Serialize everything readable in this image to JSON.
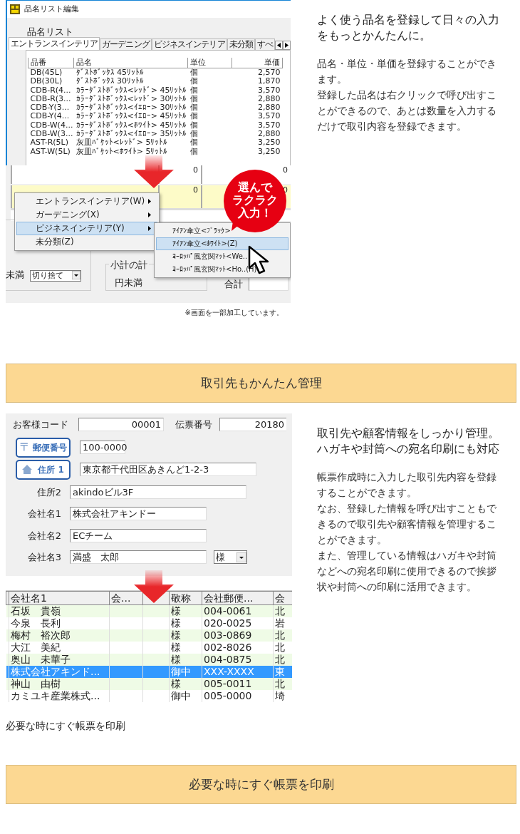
{
  "product_section": {
    "window": {
      "title": "品名リスト編集",
      "list_label": "品名リスト",
      "tabs": [
        {
          "label": "エントランスインテリア",
          "selected": true
        },
        {
          "label": "ガーデニング",
          "selected": false
        },
        {
          "label": "ビジネスインテリア",
          "selected": false
        },
        {
          "label": "未分類",
          "selected": false
        },
        {
          "label": "すべ",
          "selected": false
        }
      ],
      "table": {
        "columns": [
          "品番",
          "品名",
          "単位",
          "単価"
        ],
        "rows": [
          [
            "DB(45L)",
            "ﾀﾞｽﾄﾎﾞｯｸｽ 45ﾘｯﾄﾙ",
            "個",
            "2,570"
          ],
          [
            "DB(30L)",
            "ﾀﾞｽﾄﾎﾞｯｸｽ 30ﾘｯﾄﾙ",
            "個",
            "1,870"
          ],
          [
            "CDB-R(4...",
            "ｶﾗｰﾀﾞｽﾄﾎﾞｯｸｽ<ﾚｯﾄﾞ> 45ﾘｯﾄﾙ",
            "個",
            "3,570"
          ],
          [
            "CDB-R(3...",
            "ｶﾗｰﾀﾞｽﾄﾎﾞｯｸｽ<ﾚｯﾄﾞ> 30ﾘｯﾄﾙ",
            "個",
            "2,880"
          ],
          [
            "CDB-Y(3...",
            "ｶﾗｰﾀﾞｽﾄﾎﾞｯｸｽ<ｲｴﾛｰ> 30ﾘｯﾄﾙ",
            "個",
            "2,880"
          ],
          [
            "CDB-Y(4...",
            "ｶﾗｰﾀﾞｽﾄﾎﾞｯｸｽ<ｲｴﾛｰ> 45ﾘｯﾄﾙ",
            "個",
            "3,570"
          ],
          [
            "CDB-W(4...",
            "ｶﾗｰﾀﾞｽﾄﾎﾞｯｸｽ<ﾎﾜｲﾄ> 45ﾘｯﾄﾙ",
            "個",
            "3,570"
          ],
          [
            "CDB-W(3...",
            "ｶﾗｰﾀﾞｽﾄﾎﾞｯｸｽ<ｲｴﾛｰ> 35ﾘｯﾄﾙ",
            "個",
            "2,880"
          ],
          [
            "AST-R(5L)",
            "灰皿ﾊﾞｹｯﾄ<ﾚｯﾄﾞ> 5ﾘｯﾄﾙ",
            "個",
            "3,250"
          ],
          [
            "AST-W(5L)",
            "灰皿ﾊﾞｹｯﾄ<ﾎﾜｲﾄ> 5ﾘｯﾄﾙ",
            "個",
            "3,250"
          ]
        ]
      }
    },
    "grid": {
      "rows": [
        {
          "cells": [
            "0",
            "0"
          ],
          "selected": false
        },
        {
          "cells": [
            "0",
            "0"
          ],
          "selected": true
        }
      ]
    },
    "form": {
      "rounding_label": "未満",
      "rounding_select": "切り捨て",
      "subtotal_group": "小計の計",
      "subtotal_unit": "円未満",
      "total_label": "合計"
    },
    "context_menu": {
      "items": [
        {
          "label": "エントランスインテリア(W)",
          "submenu": true,
          "selected": false
        },
        {
          "label": "ガーデニング(X)",
          "submenu": true,
          "selected": false
        },
        {
          "label": "ビジネスインテリア(Y)",
          "submenu": true,
          "selected": true
        },
        {
          "label": "未分類(Z)",
          "submenu": false,
          "selected": false
        }
      ]
    },
    "submenu": {
      "items": [
        {
          "label": "ｱｲｱﾝ傘立<ﾌﾞﾗｯｸ>",
          "selected": false
        },
        {
          "label": "ｱｲｱﾝ傘立<ﾎﾜｲﾄ>(Z)",
          "selected": true
        },
        {
          "label": "ﾖｰﾛｯﾊﾟ風玄関ﾏｯﾄ<We..",
          "selected": false
        },
        {
          "label": "ﾖｰﾛｯﾊﾟ風玄関ﾏｯﾄ<Ho..(H)",
          "selected": false
        }
      ]
    },
    "callout": [
      "選んで",
      "ラクラク",
      "入力！"
    ],
    "note": "※画面を一部加工しています。",
    "description": {
      "headline": [
        "よく使う品名を登録して日々の入力",
        "をもっとかんたんに。"
      ],
      "body": [
        "品名・単位・単価を登録することができ",
        "ます。",
        "登録した品名は右クリックで呼び出すこ",
        "とができるので、あとは数量を入力する",
        "だけで取引内容を登録できます。"
      ]
    }
  },
  "banner_1": "取引先もかんたん管理",
  "customer_section": {
    "form": {
      "code_label": "お客様コード",
      "code_value": "00001",
      "slip_label": "伝票番号",
      "slip_value": "20180",
      "postal_button": {
        "glyph": "〒",
        "label": "郵便番号"
      },
      "postal_value": "100-0000",
      "address1_button": "住所 1",
      "address1_value": "東京都千代田区あきんど1-2-3",
      "fields": [
        {
          "label": "住所2",
          "value": "akindoビル3F",
          "wide": true
        },
        {
          "label": "会社名1",
          "value": "株式会社アキンドー",
          "wide": false
        },
        {
          "label": "会社名2",
          "value": "ECチーム",
          "wide": false
        },
        {
          "label": "会社名3",
          "value": "満盛　太郎",
          "wide": false,
          "suffix": "様"
        }
      ]
    },
    "table": {
      "columns": [
        {
          "label": "会社名1"
        },
        {
          "label": "会..."
        },
        {},
        {
          "label": "敬称"
        },
        {
          "label": "会社郵便..."
        },
        {
          "label": "会"
        }
      ],
      "rows": [
        {
          "name": "石坂　貴嶺",
          "title": "様",
          "zip": "004-0061",
          "pref": "北",
          "selected": false
        },
        {
          "name": "今泉　長利",
          "title": "様",
          "zip": "020-0025",
          "pref": "岩",
          "selected": false
        },
        {
          "name": "梅村　裕次郎",
          "title": "様",
          "zip": "003-0869",
          "pref": "北",
          "selected": false
        },
        {
          "name": "大江　美紀",
          "title": "様",
          "zip": "002-8026",
          "pref": "北",
          "selected": false
        },
        {
          "name": "奥山　未華子",
          "title": "様",
          "zip": "004-0875",
          "pref": "北",
          "selected": false
        },
        {
          "name": "株式会社アキンド...",
          "title": "御中",
          "zip": "XXX-XXXX",
          "pref": "東",
          "selected": true
        },
        {
          "name": "神山　由樹",
          "title": "様",
          "zip": "005-0011",
          "pref": "北",
          "selected": false
        },
        {
          "name": "カミユキ産業株式...",
          "title": "御中",
          "zip": "005-0000",
          "pref": "埼",
          "selected": false
        }
      ]
    },
    "caption": "必要な時にすぐ帳票を印刷",
    "description": {
      "headline": [
        "取引先や顧客情報をしっかり管理。",
        "ハガキや封筒への宛名印刷にも対応"
      ],
      "body": [
        "帳票作成時に入力した取引先内容を登録",
        "することができます。",
        "なお、登録した情報を呼び出すこともで",
        "きるので取引先や顧客情報を管理するこ",
        "とができます。",
        "また、管理している情報はハガキや封筒",
        "などへの宛名印刷に使用できるので挨拶",
        "状や封筒への印刷に活用できます。"
      ]
    }
  },
  "banner_2": "必要な時にすぐ帳票を印刷"
}
